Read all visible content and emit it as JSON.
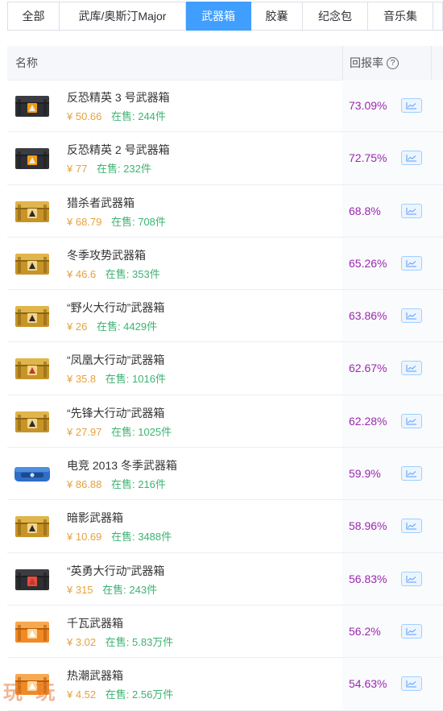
{
  "tabs": [
    {
      "label": "全部",
      "active": false
    },
    {
      "label": "武库/奥斯汀Major",
      "active": false
    },
    {
      "label": "武器箱",
      "active": true
    },
    {
      "label": "胶囊",
      "active": false
    },
    {
      "label": "纪念包",
      "active": false
    },
    {
      "label": "音乐集",
      "active": false
    },
    {
      "label": "",
      "active": false
    }
  ],
  "table": {
    "col_name": "名称",
    "col_rate": "回报率",
    "help_icon": "question-circle-icon",
    "chart_icon": "line-chart-icon",
    "rows": [
      {
        "name": "反恐精英 3 号武器箱",
        "price": "¥ 50.66",
        "on_sale": "在售: 244件",
        "rate": "73.09%",
        "case_style": "black"
      },
      {
        "name": "反恐精英 2 号武器箱",
        "price": "¥ 77",
        "on_sale": "在售: 232件",
        "rate": "72.75%",
        "case_style": "black"
      },
      {
        "name": "猎杀者武器箱",
        "price": "¥ 68.79",
        "on_sale": "在售: 708件",
        "rate": "68.8%",
        "case_style": "gold"
      },
      {
        "name": "冬季攻势武器箱",
        "price": "¥ 46.6",
        "on_sale": "在售: 353件",
        "rate": "65.26%",
        "case_style": "gold"
      },
      {
        "name": "“野火大行动”武器箱",
        "price": "¥ 26",
        "on_sale": "在售: 4429件",
        "rate": "63.86%",
        "case_style": "gold"
      },
      {
        "name": "“凤凰大行动”武器箱",
        "price": "¥ 35.8",
        "on_sale": "在售: 1016件",
        "rate": "62.67%",
        "case_style": "gold-red"
      },
      {
        "name": "“先锋大行动”武器箱",
        "price": "¥ 27.97",
        "on_sale": "在售: 1025件",
        "rate": "62.28%",
        "case_style": "gold"
      },
      {
        "name": "电竞 2013 冬季武器箱",
        "price": "¥ 86.88",
        "on_sale": "在售: 216件",
        "rate": "59.9%",
        "case_style": "blue"
      },
      {
        "name": "暗影武器箱",
        "price": "¥ 10.69",
        "on_sale": "在售: 3488件",
        "rate": "58.96%",
        "case_style": "gold"
      },
      {
        "name": "“英勇大行动”武器箱",
        "price": "¥ 315",
        "on_sale": "在售: 243件",
        "rate": "56.83%",
        "case_style": "black-red"
      },
      {
        "name": "千瓦武器箱",
        "price": "¥ 3.02",
        "on_sale": "在售: 5.83万件",
        "rate": "56.2%",
        "case_style": "orange"
      },
      {
        "name": "热潮武器箱",
        "price": "¥ 4.52",
        "on_sale": "在售: 2.56万件",
        "rate": "54.63%",
        "case_style": "orange"
      }
    ]
  },
  "colors": {
    "accent": "#409eff",
    "rate": "#9c27b0",
    "price": "#e6a23c",
    "on_sale": "#3cb371"
  },
  "watermark": "玩 玩"
}
